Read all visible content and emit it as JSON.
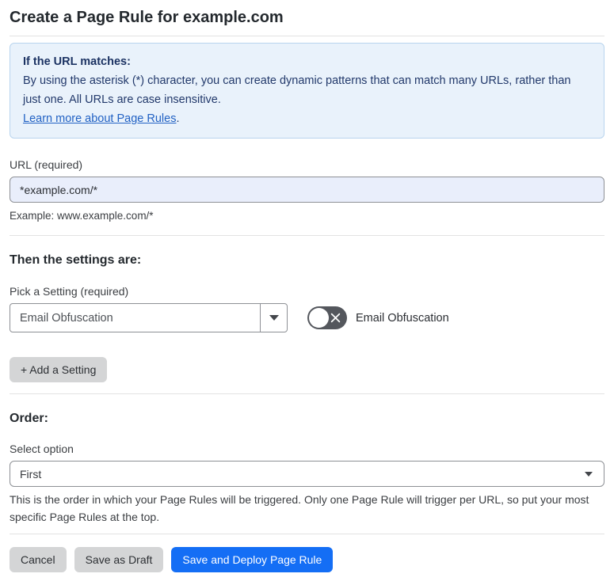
{
  "page": {
    "title": "Create a Page Rule for example.com"
  },
  "info_box": {
    "heading": "If the URL matches:",
    "body": "By using the asterisk (*) character, you can create dynamic patterns that can match many URLs, rather than just one. All URLs are case insensitive.",
    "link_label": "Learn more about Page Rules",
    "link_suffix": "."
  },
  "url_field": {
    "label": "URL (required)",
    "value": "*example.com/*",
    "example": "Example: www.example.com/*"
  },
  "settings_section": {
    "heading": "Then the settings are:",
    "picker_label": "Pick a Setting (required)",
    "picker_value": "Email Obfuscation",
    "toggle_label": "Email Obfuscation",
    "toggle_state": "off",
    "add_setting_label": "+ Add a Setting"
  },
  "order_section": {
    "heading": "Order:",
    "select_label": "Select option",
    "select_value": "First",
    "help_text": "This is the order in which your Page Rules will be triggered. Only one Page Rule will trigger per URL, so put your most specific Page Rules at the top."
  },
  "footer": {
    "cancel_label": "Cancel",
    "save_draft_label": "Save as Draft",
    "save_deploy_label": "Save and Deploy Page Rule"
  },
  "colors": {
    "accent_blue": "#146ef5",
    "info_box_bg": "#e9f2fb",
    "info_box_border": "#b8d4ee",
    "info_text": "#22396b",
    "link_blue": "#2262c4",
    "url_input_bg": "#e9eefb",
    "gray_button_bg": "#d4d5d6",
    "toggle_off_bg": "#54575d"
  }
}
